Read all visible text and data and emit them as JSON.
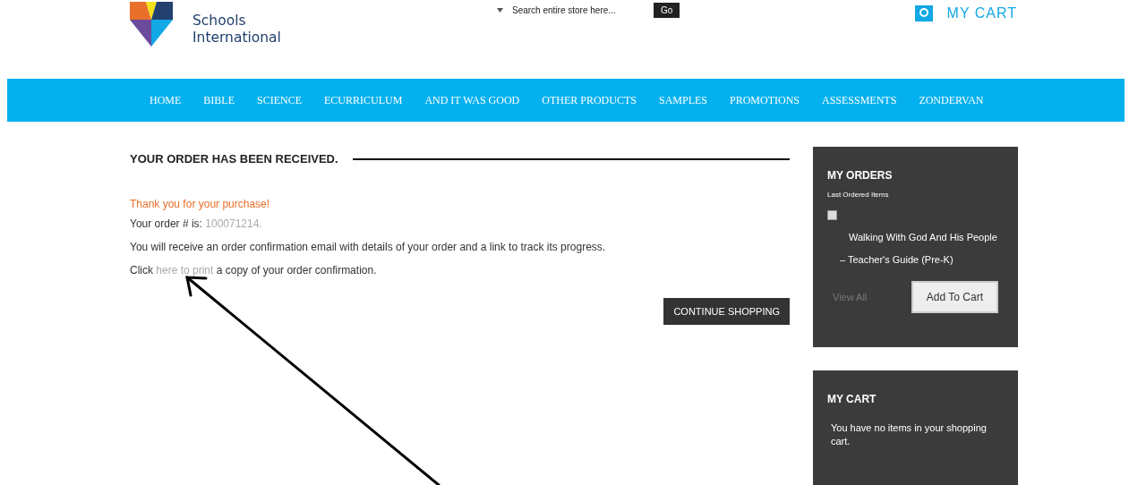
{
  "header": {
    "logo_lines": [
      "Schools",
      "International"
    ],
    "search": {
      "placeholder": "Search entire store here..."
    },
    "search_button": "Go",
    "cart_link": "MY CART"
  },
  "nav": [
    "HOME",
    "BIBLE",
    "SCIENCE",
    "ECURRICULUM",
    "AND IT WAS GOOD",
    "OTHER PRODUCTS",
    "SAMPLES",
    "PROMOTIONS",
    "ASSESSMENTS",
    "ZONDERVAN"
  ],
  "main": {
    "title": "YOUR ORDER HAS BEEN RECEIVED.",
    "thanks": "Thank you for your purchase!",
    "order_label": "Your order # is:",
    "order_number": "100071214",
    "order_end": ".",
    "email_note": "You will receive an order confirmation email with details of your order and a link to track its progress.",
    "print_before": "Click",
    "print_link": "here to print",
    "print_after": "a copy of your order confirmation.",
    "continue_button": "CONTINUE SHOPPING"
  },
  "my_orders": {
    "title": "MY ORDERS",
    "subtitle": "Last Ordered Items",
    "items": [
      {
        "checked": false,
        "name_line_1": "Walking With God And His People",
        "name_line_2": "– Teacher's Guide (Pre-K)"
      }
    ],
    "view_all": "View All",
    "add_button": "Add To Cart"
  },
  "my_cart": {
    "title": "MY CART",
    "message": "You have no items in your shopping cart."
  }
}
